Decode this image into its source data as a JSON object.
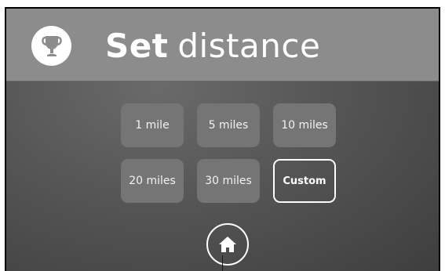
{
  "header": {
    "icon": "trophy-icon",
    "title_bold": "Set",
    "title_light": "distance"
  },
  "options": [
    {
      "label": "1 mile",
      "selected": false
    },
    {
      "label": "5 miles",
      "selected": false
    },
    {
      "label": "10 miles",
      "selected": false
    },
    {
      "label": "20 miles",
      "selected": false
    },
    {
      "label": "30 miles",
      "selected": false
    },
    {
      "label": "Custom",
      "selected": true
    }
  ],
  "home": {
    "icon": "home-icon"
  },
  "colors": {
    "header_bg": "#8c8c8c",
    "button_bg": "#757575",
    "text": "#ffffff"
  }
}
